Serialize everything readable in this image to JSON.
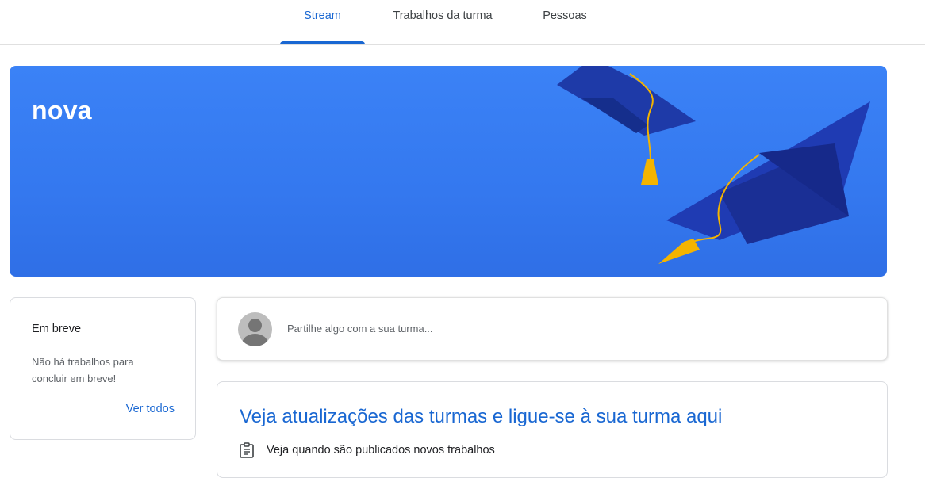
{
  "nav": {
    "tabs": [
      {
        "label": "Stream",
        "active": true
      },
      {
        "label": "Trabalhos da turma",
        "active": false
      },
      {
        "label": "Pessoas",
        "active": false
      }
    ]
  },
  "banner": {
    "title": "nova",
    "illustration": "graduation-caps"
  },
  "upcoming": {
    "title": "Em breve",
    "text": "Não há trabalhos para concluir em breve!",
    "link": "Ver todos"
  },
  "share": {
    "placeholder": "Partilhe algo com a sua turma..."
  },
  "updates": {
    "title": "Veja atualizações das turmas e ligue-se à sua turma aqui",
    "items": [
      {
        "icon": "assignment-icon",
        "text": "Veja quando são publicados novos trabalhos"
      }
    ]
  },
  "colors": {
    "accent": "#1967d2",
    "banner": "#3b82f6",
    "cap": "#1a237e",
    "tassel": "#f4b400"
  }
}
